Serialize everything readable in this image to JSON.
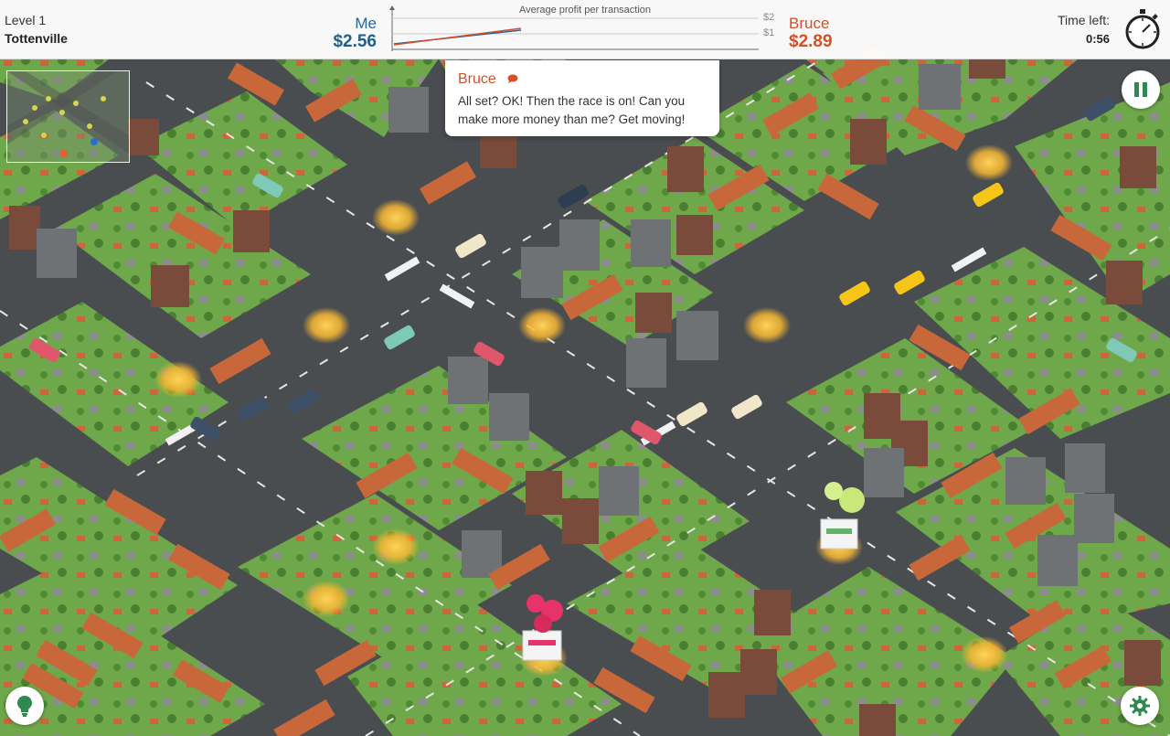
{
  "level": {
    "number_label": "Level 1",
    "name": "Tottenville"
  },
  "me": {
    "name": "Me",
    "value": "$2.56",
    "color": "#1f5f8b"
  },
  "opponent": {
    "name": "Bruce",
    "value": "$2.89",
    "color": "#d0512a"
  },
  "profit_chart": {
    "title": "Average profit per transaction",
    "y_ticks": [
      "$2",
      "$1"
    ]
  },
  "timer": {
    "label": "Time left:",
    "value": "0:56"
  },
  "dialog": {
    "speaker": "Bruce",
    "message": "All set? OK! Then the race is on! Can you make more money than me? Get moving!"
  },
  "icons": {
    "pause": "pause-icon",
    "hint": "lightbulb-icon",
    "settings": "gear-icon",
    "timer": "stopwatch-icon",
    "speech": "speech-bubble-icon"
  },
  "colors": {
    "road": "#4a4d50",
    "grass": "#6fa84a",
    "roof": "#c8683a",
    "glow": "#f7b733",
    "me_store": "#c8e87a",
    "opponent_store": "#e8336a"
  }
}
